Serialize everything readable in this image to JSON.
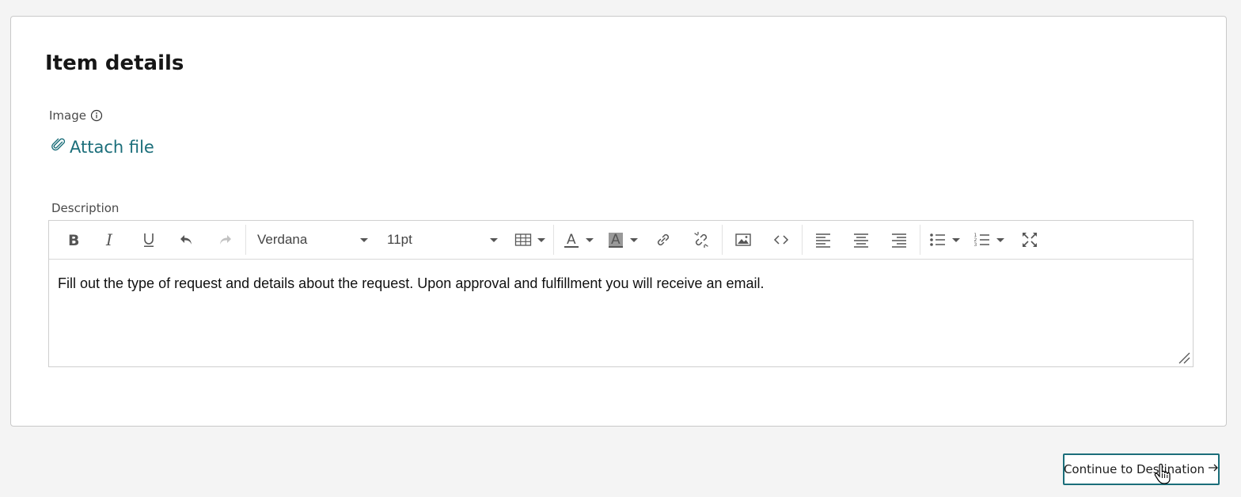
{
  "card": {
    "title": "Item details"
  },
  "image_field": {
    "label": "Image",
    "info_icon": "info-circle-icon",
    "attach_label": "Attach file",
    "attach_icon": "paperclip-icon"
  },
  "description_field": {
    "label": "Description",
    "toolbar": {
      "font_family": "Verdana",
      "font_size": "11pt",
      "buttons": [
        "bold",
        "italic",
        "underline",
        "undo",
        "redo",
        "table",
        "text-color",
        "background-color",
        "link",
        "unlink",
        "image",
        "code",
        "align-left",
        "align-center",
        "align-right",
        "bullet-list",
        "numbered-list",
        "fullscreen"
      ]
    },
    "content": "Fill out the type of request and details about the request. Upon approval and fulfillment you will receive an email."
  },
  "footer": {
    "continue_label": "Continue to Destination",
    "continue_icon": "arrow-right-icon"
  },
  "colors": {
    "accent": "#1b6e7a",
    "background": "#f4f4f4",
    "card": "#ffffff"
  }
}
